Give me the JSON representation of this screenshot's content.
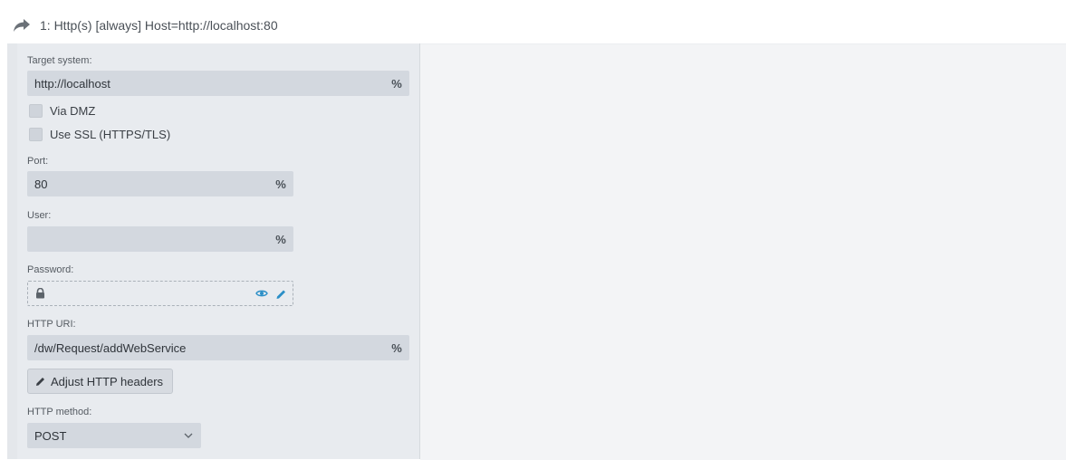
{
  "header": {
    "title": "1: Http(s) [always] Host=http://localhost:80"
  },
  "form": {
    "target_label": "Target system:",
    "target_value": "http://localhost",
    "via_dmz_label": "Via DMZ",
    "use_ssl_label": "Use SSL (HTTPS/TLS)",
    "port_label": "Port:",
    "port_value": "80",
    "user_label": "User:",
    "user_value": "",
    "password_label": "Password:",
    "uri_label": "HTTP URI:",
    "uri_value": "/dw/Request/addWebService",
    "headers_button_label": "Adjust HTTP headers",
    "method_label": "HTTP method:",
    "method_value": "POST",
    "variable_symbol": "%"
  },
  "icons": {
    "header": "share-arrow-icon",
    "lock": "lock-icon",
    "eye": "eye-icon",
    "edit": "pencil-icon",
    "dropdown": "chevron-down-icon"
  },
  "colors": {
    "panel_bg": "#e8ebef",
    "field_bg": "#d3d8df",
    "accent": "#2b8fc7"
  }
}
